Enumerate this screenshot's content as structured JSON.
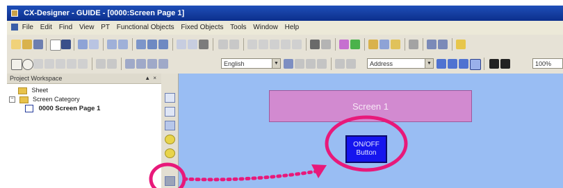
{
  "window": {
    "title": "CX-Designer - GUIDE - [0000:Screen Page 1]"
  },
  "menu": {
    "items": [
      "File",
      "Edit",
      "Find",
      "View",
      "PT",
      "Functional Objects",
      "Fixed Objects",
      "Tools",
      "Window",
      "Help"
    ]
  },
  "toolbar": {
    "language_combo": "English",
    "address_combo": "Address",
    "zoom_value": "100%"
  },
  "workspace": {
    "title": "Project Workspace",
    "pin_label": "▲ ×",
    "tree": {
      "sheet": "Sheet",
      "screen_category": "Screen Category",
      "screen_page": "0000 Screen Page 1"
    }
  },
  "canvas": {
    "screen_label": "Screen 1",
    "button_line1": "ON/OFF",
    "button_line2": "Button"
  },
  "colors": {
    "highlight": "#e8197a",
    "canvas": "#99bdf3",
    "button": "#1515ee",
    "screen_bar": "#d28ad0"
  }
}
